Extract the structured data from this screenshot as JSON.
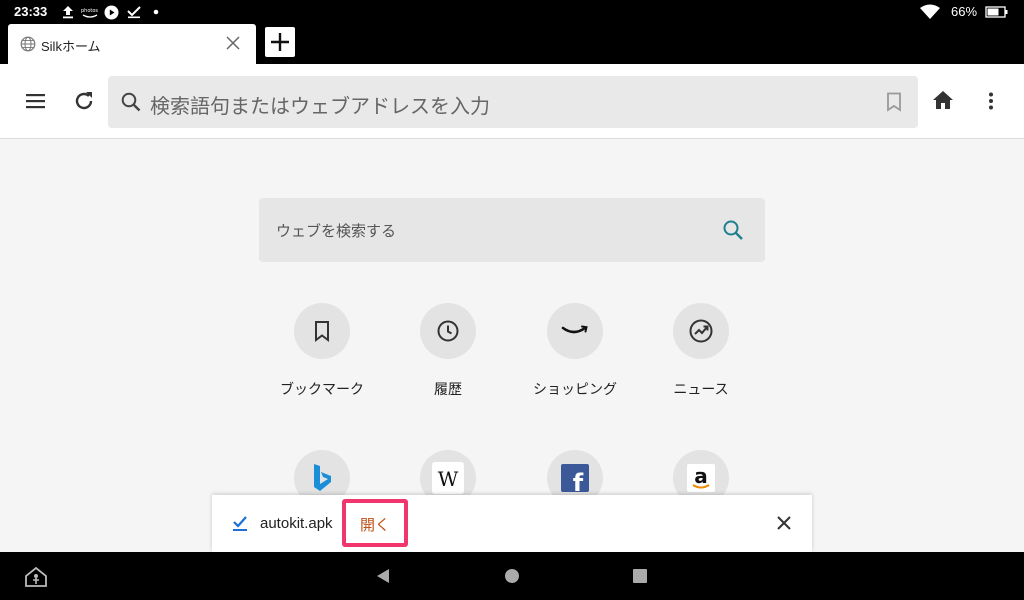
{
  "status_bar": {
    "time": "23:33",
    "battery": "66%",
    "icons": [
      "upload-icon",
      "photos-icon",
      "play-icon",
      "check-icon",
      "dot-icon",
      "wifi-icon",
      "battery-icon"
    ]
  },
  "tabs": [
    {
      "title": "Silkホーム",
      "icon": "globe-icon"
    }
  ],
  "toolbar": {
    "url_placeholder": "検索語句またはウェブアドレスを入力",
    "icons": [
      "menu-icon",
      "reload-icon",
      "search-icon",
      "bookmark-icon",
      "home-icon",
      "more-icon"
    ]
  },
  "web_search": {
    "placeholder": "ウェブを検索する"
  },
  "shortcuts": [
    {
      "label": "ブックマーク",
      "icon": "bookmark-icon"
    },
    {
      "label": "履歴",
      "icon": "history-icon"
    },
    {
      "label": "ショッピング",
      "icon": "amazon-smile-icon"
    },
    {
      "label": "ニュース",
      "icon": "trending-icon"
    }
  ],
  "sites": [
    {
      "name": "bing",
      "icon": "bing-icon"
    },
    {
      "name": "wikipedia",
      "icon": "wikipedia-icon"
    },
    {
      "name": "facebook",
      "icon": "facebook-icon"
    },
    {
      "name": "amazon",
      "icon": "amazon-icon"
    }
  ],
  "download_bar": {
    "filename": "autokit.apk",
    "open_label": "開く"
  },
  "colors": {
    "highlight": "#f0366c",
    "open_text": "#c05018",
    "search_accent": "#1e7f8e",
    "facebook": "#3b5998",
    "bing": "#1a8fd8",
    "amazon_orange": "#f08a00"
  }
}
